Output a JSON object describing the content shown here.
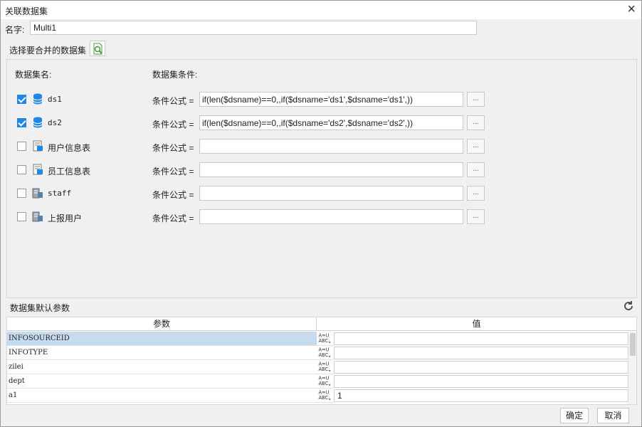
{
  "dialog": {
    "title": "关联数据集"
  },
  "name": {
    "label": "名字:",
    "value": "Multi1"
  },
  "choose": {
    "label": "选择要合并的数据集"
  },
  "headers": {
    "ds_name": "数据集名:",
    "ds_cond": "数据集条件:"
  },
  "datasets": [
    {
      "name": "ds1",
      "checked": true,
      "icon": "database-icon",
      "cond_label": "条件公式 =",
      "formula": "if(len($dsname)==0,,if($dsname='ds1',$dsname='ds1',))"
    },
    {
      "name": "ds2",
      "checked": true,
      "icon": "database-icon",
      "cond_label": "条件公式 =",
      "formula": "if(len($dsname)==0,,if($dsname='ds2',$dsname='ds2',))"
    },
    {
      "name": "用户信息表",
      "checked": false,
      "icon": "table-dataset-icon",
      "cond_label": "条件公式 =",
      "formula": ""
    },
    {
      "name": "员工信息表",
      "checked": false,
      "icon": "table-dataset-icon",
      "cond_label": "条件公式 =",
      "formula": ""
    },
    {
      "name": "staff",
      "checked": false,
      "icon": "server-dataset-icon",
      "cond_label": "条件公式 =",
      "formula": ""
    },
    {
      "name": "上报用户",
      "checked": false,
      "icon": "server-dataset-icon",
      "cond_label": "条件公式 =",
      "formula": ""
    }
  ],
  "ellipsis": "...",
  "params": {
    "title": "数据集默认参数",
    "col_param": "参数",
    "col_value": "值",
    "rows": [
      {
        "name": "INFOSOURCEID",
        "value": ""
      },
      {
        "name": "INFOTYPE",
        "value": ""
      },
      {
        "name": "zilei",
        "value": ""
      },
      {
        "name": "dept",
        "value": ""
      },
      {
        "name": "a1",
        "value": "1"
      }
    ]
  },
  "buttons": {
    "ok": "确定",
    "cancel": "取消"
  },
  "colors": {
    "accent": "#1e88e5",
    "selected_row": "#c6dcee",
    "db_icon": "#1e88e5"
  }
}
